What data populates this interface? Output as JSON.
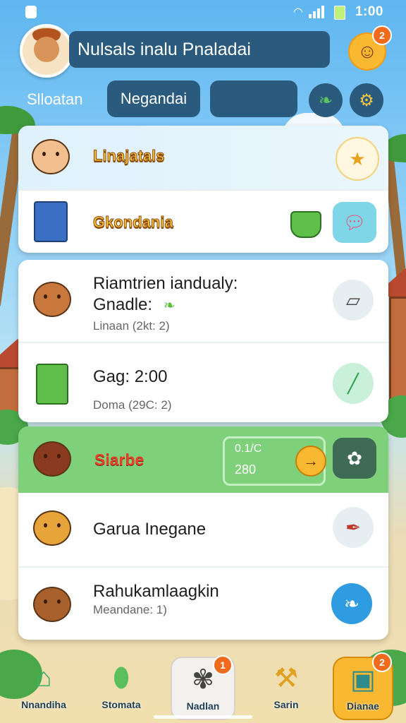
{
  "status_bar": {
    "time": "1:00",
    "wifi_icon": "wifi-icon",
    "signal_icon": "signal-icon",
    "battery_icon": "battery-icon"
  },
  "header": {
    "title": "Nulsals inalu Pnaladai",
    "notification_count": "2",
    "section_label": "Slloatan",
    "search_value": "Negandai",
    "second_field_value": ""
  },
  "card_top": [
    {
      "label": "Linajatals",
      "action_icon": "star-badge-icon"
    },
    {
      "label": "Gkondania",
      "action_icon": "chat-bubble-icon"
    }
  ],
  "card_tasks": [
    {
      "title": "Riamtrien iandualy:",
      "subtitle": "Gnadle:",
      "meta": "Linaan (2kt: 2)",
      "action_icon": "map-icon"
    },
    {
      "title": "Gag: 2:00",
      "meta": "Doma (29C: 2)",
      "action_icon": "stick-icon"
    }
  ],
  "card_bottom": {
    "highlight": {
      "label": "Siarbe",
      "progress_top": "0.1/C",
      "progress_bottom": "280",
      "go_icon": "arrow-right-icon",
      "action_icon": "flower-icon"
    },
    "items": [
      {
        "title": "Garua Inegane",
        "action_icon": "brush-icon"
      },
      {
        "title": "Rahukamlaagkin",
        "meta": "Meandane: 1)",
        "action_icon": "leaf-icon"
      }
    ]
  },
  "bottom_nav": [
    {
      "label": "Nnandiha",
      "icon": "house-icon"
    },
    {
      "label": "Stomata",
      "icon": "bottle-icon"
    },
    {
      "label": "Nadlan",
      "icon": "flower-bag-icon",
      "badge": "1"
    },
    {
      "label": "Sarin",
      "icon": "tools-icon"
    },
    {
      "label": "Dianae",
      "icon": "map-box-icon",
      "badge": "2"
    }
  ],
  "colors": {
    "header_dark": "#2a5a7d",
    "accent_orange": "#f26b1d",
    "highlight_green": "#7fd07a",
    "sky": "#5fb6f0"
  }
}
